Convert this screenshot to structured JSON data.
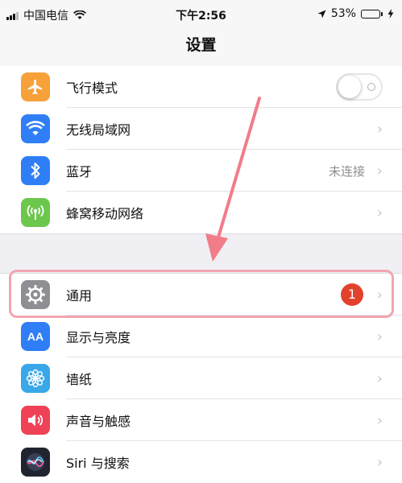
{
  "status_bar": {
    "carrier": "中国电信",
    "time": "下午2:56",
    "battery_text": "53%",
    "battery_level": 0.53,
    "battery_color": "#4cd964"
  },
  "nav": {
    "title": "设置"
  },
  "rows": [
    {
      "label": "飞行模式",
      "icon": "airplane-icon",
      "icon_color": "#f7a13a",
      "toggle_on": false
    },
    {
      "label": "无线局域网",
      "icon": "wifi-icon",
      "icon_color": "#2f7ef6"
    },
    {
      "label": "蓝牙",
      "icon": "bluetooth-icon",
      "icon_color": "#2f7ef6",
      "detail": "未连接"
    },
    {
      "label": "蜂窝移动网络",
      "icon": "cellular-icon",
      "icon_color": "#6cc84c"
    },
    {
      "label": "通用",
      "icon": "gear-icon",
      "icon_color": "#8e8e93",
      "badge": "1"
    },
    {
      "label": "显示与亮度",
      "icon": "display-icon",
      "icon_color": "#2f7ef6",
      "icon_text": "AA"
    },
    {
      "label": "墙纸",
      "icon": "wallpaper-icon",
      "icon_color": "#39a7e8"
    },
    {
      "label": "声音与触感",
      "icon": "sound-icon",
      "icon_color": "#ef4256"
    },
    {
      "label": "Siri 与搜索",
      "icon": "siri-icon",
      "icon_color": "#20242f"
    }
  ],
  "chevron": "›",
  "highlight_color": "#f0a6b0",
  "arrow_color": "#f07d88"
}
